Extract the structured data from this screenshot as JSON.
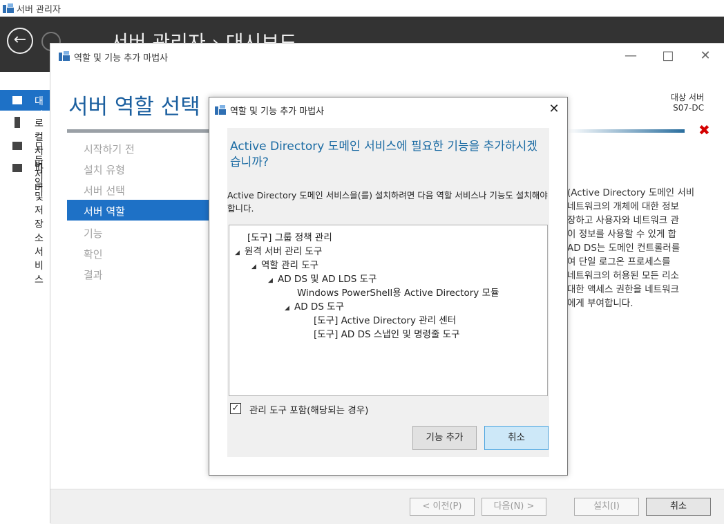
{
  "server_manager": {
    "window_title": "서버 관리자",
    "heading": "서버 관리자 › 대시보드",
    "nav": [
      "대시보드",
      "로컬 서버",
      "모든 서버",
      "파일 및 저장소 서비스"
    ]
  },
  "wizard": {
    "window_title": "역할 및 기능 추가 마법사",
    "heading": "서버 역할 선택",
    "target_label": "대상 서버",
    "target_server": "S07-DC",
    "steps": [
      "시작하기 전",
      "설치 유형",
      "서버 선택",
      "서버 역할",
      "기능",
      "확인",
      "결과"
    ],
    "active_step": "서버 역할",
    "description": "(Active Directory 도메인 서비\n네트워크의 개체에 대한 정보\n장하고 사용자와 네트워크 관\n이 정보를 사용할 수 있게 합\nAD DS는 도메인 컨트롤러를\n여 단일 로그온 프로세스를\n네트워크의 허용된 모든 리소\n대한 액세스 권한을 네트워크\n에게 부여합니다.",
    "buttons": {
      "prev": "< 이전(P)",
      "next": "다음(N) >",
      "install": "설치(I)",
      "cancel": "취소"
    }
  },
  "dialog": {
    "title": "역할 및 기능 추가 마법사",
    "question": "Active Directory 도메인 서비스에 필요한 기능을 추가하시겠습니까?",
    "explanation": "Active Directory 도메인 서비스을(를) 설치하려면 다음 역할 서비스나 기능도 설치해야 합니다.",
    "tree": [
      "[도구] 그룹 정책 관리",
      "원격 서버 관리 도구",
      "역할 관리 도구",
      "AD DS 및 AD LDS 도구",
      "Windows PowerShell용 Active Directory 모듈",
      "AD DS 도구",
      "[도구] Active Directory 관리 센터",
      "[도구] AD DS 스냅인 및 명령줄 도구"
    ],
    "include_tools_label": "관리 도구 포함(해당되는 경우)",
    "include_tools_checked": true,
    "add_button": "기능 추가",
    "cancel_button": "취소"
  }
}
